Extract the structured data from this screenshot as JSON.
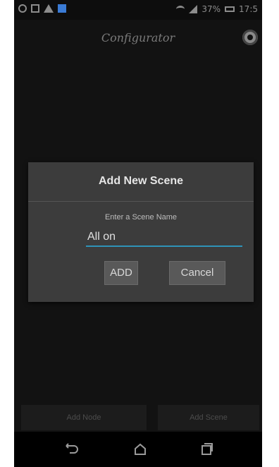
{
  "app_bar": {
    "title": "Configurator"
  },
  "status_bar": {
    "battery_text": "37%",
    "time_text": "17:5"
  },
  "dialog": {
    "title": "Add New Scene",
    "prompt": "Enter a Scene Name",
    "input_value": "All on",
    "add_label": "ADD",
    "cancel_label": "Cancel"
  },
  "bottom_buttons": {
    "add_node": "Add Node",
    "add_scene": "Add Scene"
  },
  "icons": {
    "settings": "gear-icon",
    "nav_back": "back-icon",
    "nav_home": "home-icon",
    "nav_recent": "recent-apps-icon"
  },
  "colors": {
    "accent": "#2e93b8",
    "dialog_bg": "#3c3c3c",
    "screen_bg": "#121212"
  }
}
